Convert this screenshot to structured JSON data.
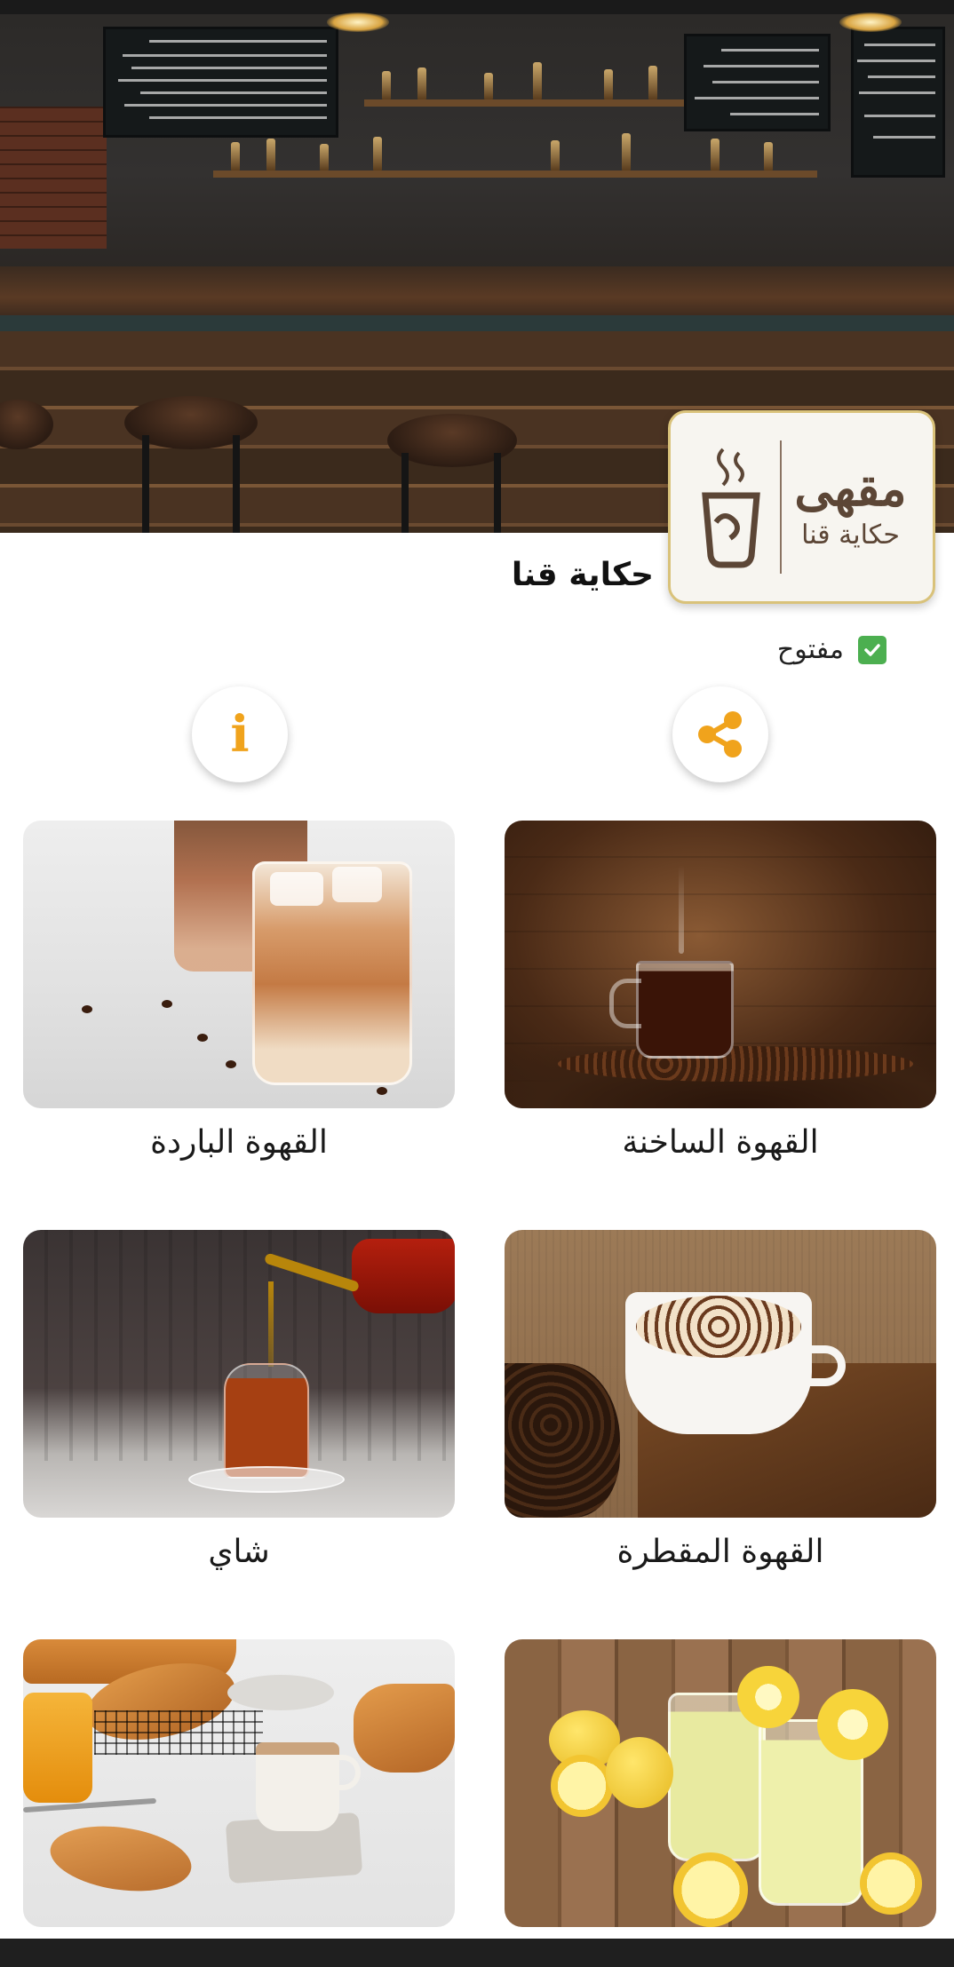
{
  "shop": {
    "logo_main": "مقهى",
    "logo_sub": "حكاية قنا",
    "name": "حكاية قنا",
    "status": "مفتوح"
  },
  "actions": {
    "share_icon": "share-icon",
    "info_icon": "info-icon",
    "info_glyph": "i"
  },
  "categories": [
    {
      "id": "hot",
      "label": "القهوة الساخنة"
    },
    {
      "id": "cold",
      "label": "القهوة الباردة"
    },
    {
      "id": "drip",
      "label": "القهوة المقطرة"
    },
    {
      "id": "tea",
      "label": "شاي"
    },
    {
      "id": "lemon",
      "label": ""
    },
    {
      "id": "bakery",
      "label": ""
    }
  ],
  "colors": {
    "accent": "#f0a31c",
    "open_badge": "#4caf50",
    "logo_border": "#d9c27a"
  }
}
